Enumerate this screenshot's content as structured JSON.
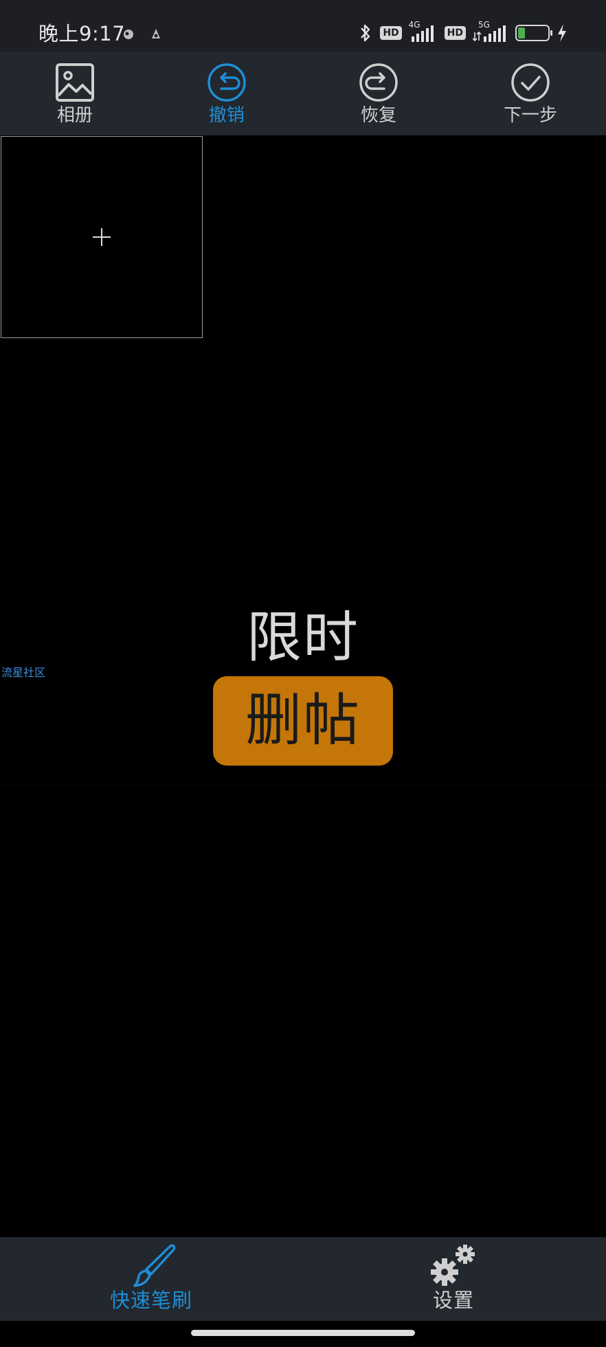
{
  "status_bar": {
    "time": "晚上9:17",
    "hd_label": "HD",
    "network_1": "4G",
    "network_2": "5G",
    "battery_level": "25",
    "battery_percent": 25
  },
  "toolbar": {
    "album": "相册",
    "undo": "撤销",
    "redo": "恢复",
    "next": "下一步",
    "active_item": "undo"
  },
  "canvas": {
    "watermark_title": "限时",
    "watermark_button": "删帖",
    "side_tag": "流星社区"
  },
  "bottom_bar": {
    "brush": "快速笔刷",
    "settings": "设置"
  },
  "colors": {
    "accent": "#1e8ed6",
    "toolbar_bg": "#23272e",
    "status_bg": "#1d1f24",
    "watermark_button_bg": "#c47608",
    "battery_fill": "#4caf50"
  }
}
